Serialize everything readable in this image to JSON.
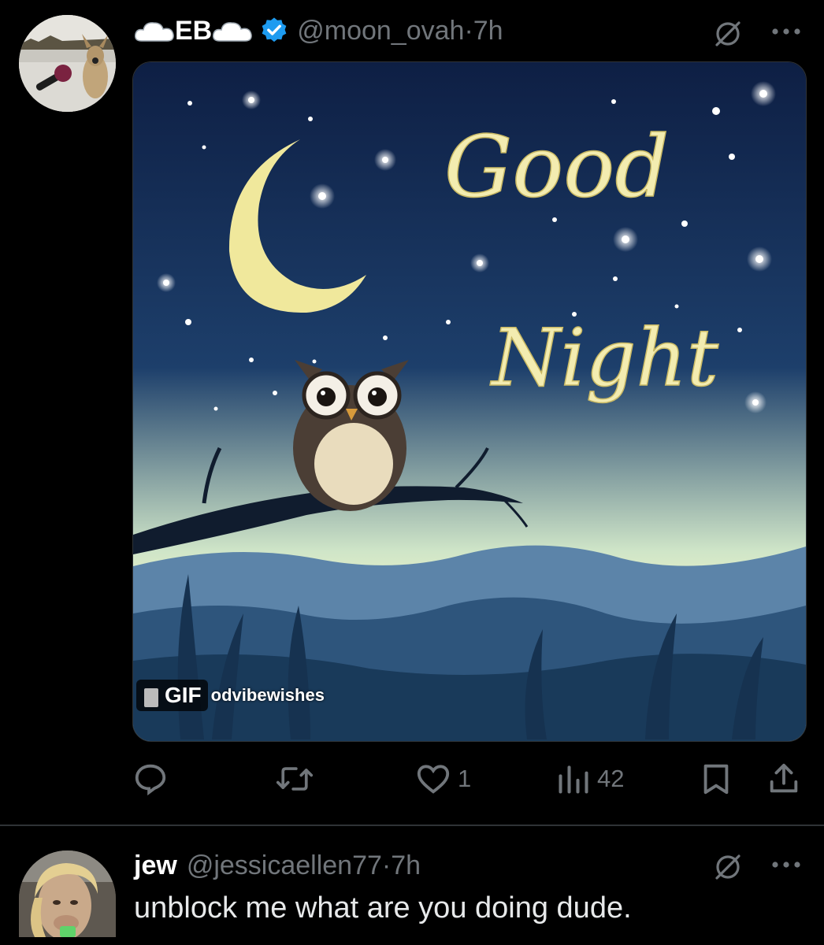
{
  "tweet": {
    "author_name": "EB",
    "handle": "@moon_ovah",
    "separator": "·",
    "time": "7h",
    "media": {
      "badge": "GIF",
      "source_text": "odvibewishes",
      "art_line1": "Good",
      "art_line2": "Night"
    },
    "actions": {
      "reply_count": "",
      "retweet_count": "",
      "like_count": "1",
      "views_count": "42"
    }
  },
  "reply": {
    "author_name": "jew",
    "handle": "@jessicaellen77",
    "separator": "·",
    "time": "7h",
    "text": "unblock me what are you doing dude."
  },
  "colors": {
    "background": "#000000",
    "muted": "#71767b",
    "verified": "#1d9bf0",
    "divider": "#2f3336"
  }
}
